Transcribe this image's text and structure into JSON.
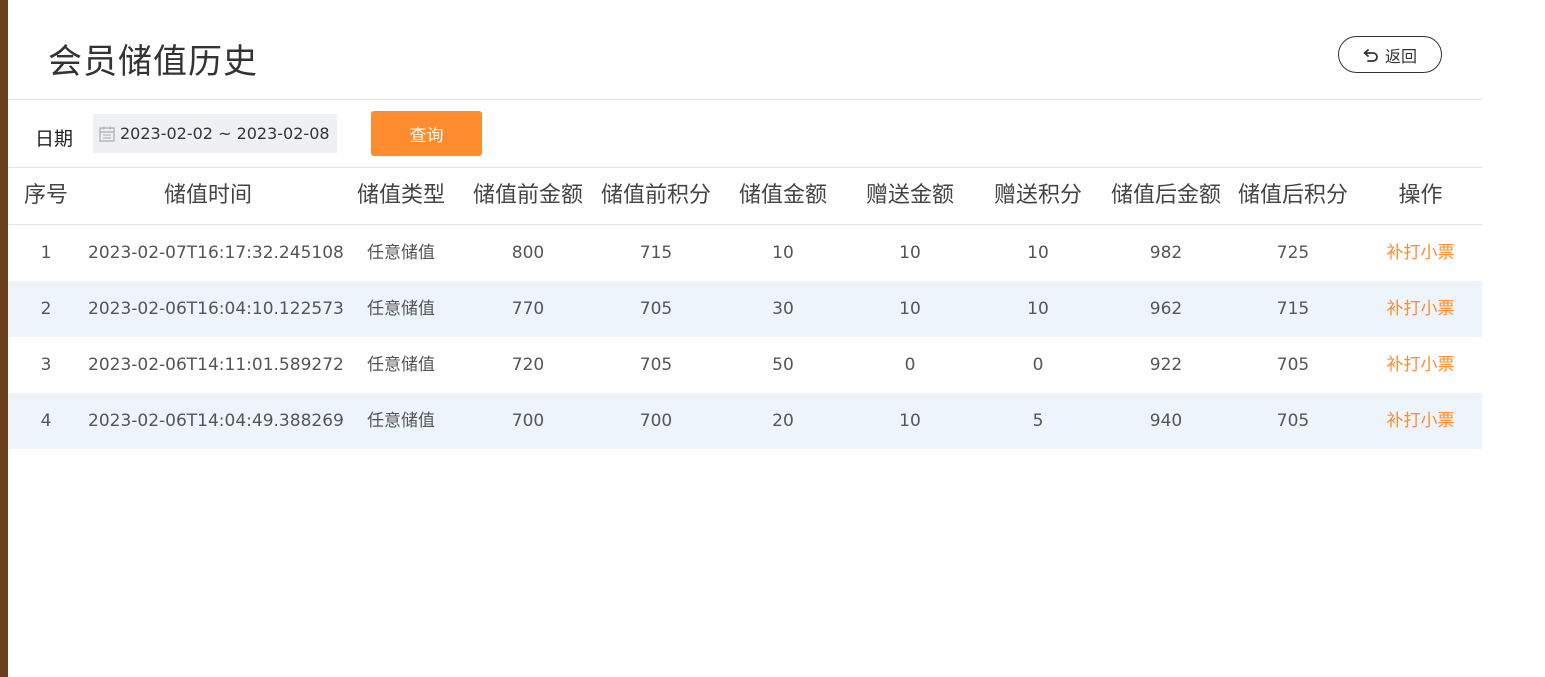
{
  "title": "会员储值历史",
  "back_label": "返回",
  "filter": {
    "date_label": "日期",
    "date_range": "2023-02-02 ~ 2023-02-08",
    "query_label": "查询"
  },
  "table": {
    "headers": [
      "序号",
      "储值时间",
      "储值类型",
      "储值前金额",
      "储值前积分",
      "储值金额",
      "赠送金额",
      "赠送积分",
      "储值后金额",
      "储值后积分",
      "操作"
    ],
    "rows": [
      [
        "1",
        "2023-02-07T16:17:32.245108",
        "任意储值",
        "800",
        "715",
        "10",
        "10",
        "10",
        "982",
        "725",
        "补打小票"
      ],
      [
        "2",
        "2023-02-06T16:04:10.122573",
        "任意储值",
        "770",
        "705",
        "30",
        "10",
        "10",
        "962",
        "715",
        "补打小票"
      ],
      [
        "3",
        "2023-02-06T14:11:01.589272",
        "任意储值",
        "720",
        "705",
        "50",
        "0",
        "0",
        "922",
        "705",
        "补打小票"
      ],
      [
        "4",
        "2023-02-06T14:04:49.388269",
        "任意储值",
        "700",
        "700",
        "20",
        "10",
        "5",
        "940",
        "705",
        "补打小票"
      ]
    ]
  },
  "colors": {
    "accent": "#ff8c2e",
    "stripe": "#eef4fb",
    "border": "#e3e3e3",
    "sidebar_strip": "#6b3f1d"
  },
  "icons": {
    "back": "return-arrow-icon",
    "calendar": "calendar-icon"
  }
}
